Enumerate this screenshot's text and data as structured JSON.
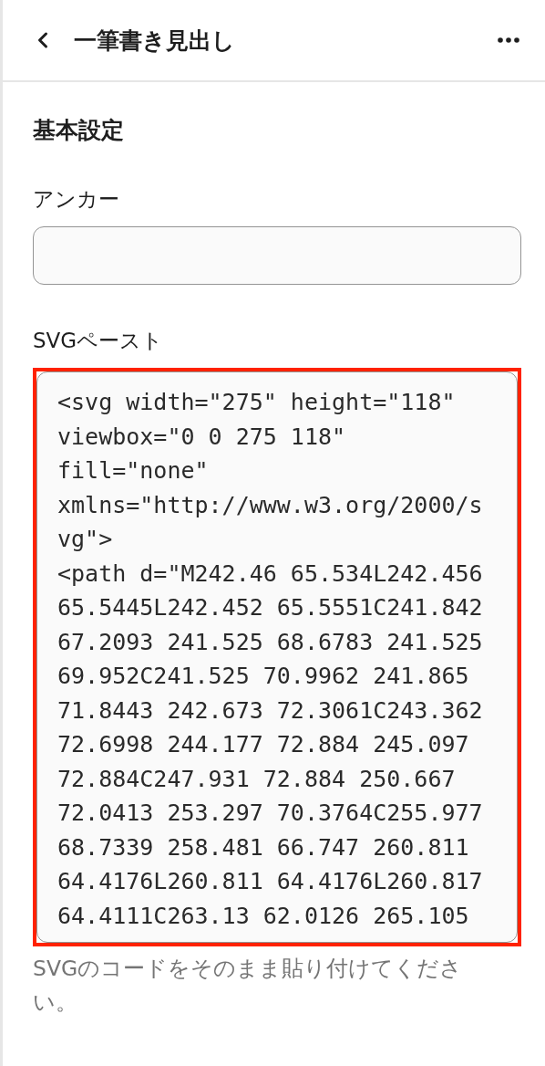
{
  "header": {
    "title": "一筆書き見出し"
  },
  "section_title": "基本設定",
  "fields": [
    {
      "kind": "input",
      "label": "アンカー"
    },
    {
      "kind": "code",
      "label": "SVGペースト",
      "highlighted": true,
      "lines": [
        "<svg width=\"275\" height=\"118\"",
        "viewbox=\"0 0 275 118\"",
        "fill=\"none\"",
        "xmlns=\"http://www.w3.org/2000/s",
        "vg\">",
        "<path d=\"M242.46 65.534L242.456",
        "65.5445L242.452 65.5551C241.842",
        "67.2093 241.525 68.6783 241.525",
        "69.952C241.525 70.9962 241.865",
        "71.8443 242.673 72.3061C243.362",
        "72.6998 244.177 72.884 245.097",
        "72.884C247.931 72.884 250.667",
        "72.0413 253.297 70.3764C255.977",
        "68.7339 258.481 66.747 260.811",
        "64.4176L260.811 64.4176L260.817",
        "64.4111C263.13 62.0126 265.105"
      ],
      "help": "SVGのコードをそのまま貼り付けてください。"
    }
  ]
}
